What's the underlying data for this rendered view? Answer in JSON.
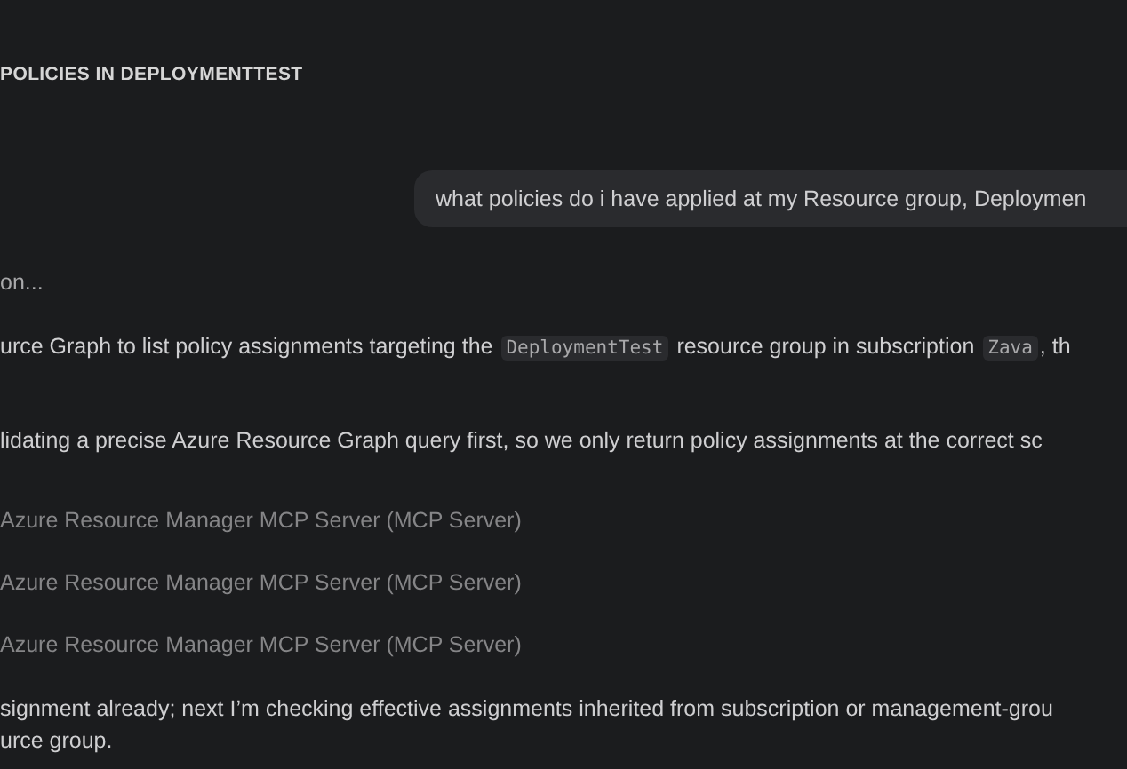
{
  "header": "POLICIES IN DEPLOYMENTTEST",
  "user_message": "what policies do i have applied at my Resource group, Deploymen",
  "progress_text": "on...",
  "blocks": [
    {
      "kind": "paragraph",
      "segments": [
        {
          "kind": "text",
          "text": "urce Graph to list policy assignments targeting the "
        },
        {
          "kind": "code",
          "text": "DeploymentTest"
        },
        {
          "kind": "text",
          "text": " resource group in subscription "
        },
        {
          "kind": "code",
          "text": "Zava"
        },
        {
          "kind": "text",
          "text": ", th"
        }
      ]
    },
    {
      "kind": "paragraph",
      "segments": [
        {
          "kind": "text",
          "text": "lidating a precise Azure Resource Graph query first, so we only return policy assignments at the correct sc"
        }
      ]
    },
    {
      "kind": "tool",
      "text": "Azure Resource Manager MCP Server (MCP Server)"
    },
    {
      "kind": "tool",
      "text": "Azure Resource Manager MCP Server (MCP Server)"
    },
    {
      "kind": "tool",
      "text": "Azure Resource Manager MCP Server (MCP Server)"
    },
    {
      "kind": "paragraph",
      "segments": [
        {
          "kind": "text",
          "text": "signment already; next I’m checking effective assignments inherited from subscription or management-grou"
        }
      ]
    },
    {
      "kind": "paragraph",
      "segments": [
        {
          "kind": "text",
          "text": "urce group."
        }
      ]
    }
  ]
}
